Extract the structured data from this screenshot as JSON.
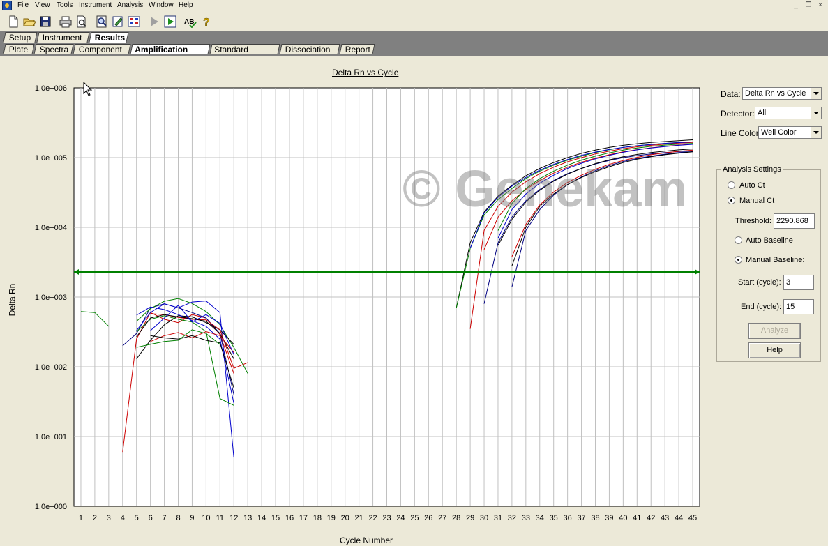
{
  "menu": [
    "File",
    "View",
    "Tools",
    "Instrument",
    "Analysis",
    "Window",
    "Help"
  ],
  "window_buttons": [
    "_",
    "❐",
    "×"
  ],
  "main_tabs": [
    "Setup",
    "Instrument",
    "Results"
  ],
  "result_tabs": [
    "Plate",
    "Spectra",
    "Component",
    "Amplification Plot",
    "Standard Curve",
    "Dissociation",
    "Report"
  ],
  "watermark": "© Genekam",
  "controls": {
    "data_label": "Data:",
    "data_value": "Delta Rn vs Cycle",
    "detector_label": "Detector:",
    "detector_value": "All",
    "line_color_label": "Line Color:",
    "line_color_value": "Well Color",
    "analysis_settings": "Analysis Settings",
    "auto_ct": "Auto Ct",
    "manual_ct": "Manual Ct",
    "threshold_label": "Threshold:",
    "threshold_value": "2290.868",
    "auto_baseline": "Auto Baseline",
    "manual_baseline": "Manual Baseline:",
    "start_label": "Start (cycle):",
    "start_value": "3",
    "end_label": "End (cycle):",
    "end_value": "15",
    "analyze_button": "Analyze",
    "help_button": "Help",
    "selected_ct_mode": "manual",
    "selected_baseline_mode": "manual"
  },
  "chart_data": {
    "type": "line",
    "title": "Delta Rn vs Cycle",
    "xlabel": "Cycle Number",
    "ylabel": "Delta Rn",
    "yscale": "log",
    "xlim": [
      1,
      45
    ],
    "ylim": [
      1,
      1000000
    ],
    "x_ticks": [
      "1",
      "2",
      "3",
      "4",
      "5",
      "6",
      "7",
      "8",
      "9",
      "10",
      "11",
      "12",
      "13",
      "14",
      "15",
      "16",
      "17",
      "18",
      "19",
      "20",
      "21",
      "22",
      "23",
      "24",
      "25",
      "26",
      "27",
      "28",
      "29",
      "30",
      "31",
      "32",
      "33",
      "34",
      "35",
      "36",
      "37",
      "38",
      "39",
      "40",
      "41",
      "42",
      "43",
      "44",
      "45"
    ],
    "y_ticks": [
      "1.0e+000",
      "1.0e+001",
      "1.0e+002",
      "1.0e+003",
      "1.0e+004",
      "1.0e+005",
      "1.0e+006"
    ],
    "threshold": 2290.868,
    "threshold_color": "#008000",
    "grid": true,
    "series": [
      {
        "color": "#008000",
        "x": [
          1,
          2,
          3
        ],
        "y": [
          620,
          600,
          380
        ]
      },
      {
        "color": "#cc0000",
        "x": [
          4,
          5,
          6,
          7,
          8,
          9,
          10,
          11,
          12
        ],
        "y": [
          6,
          250,
          600,
          480,
          430,
          560,
          500,
          290,
          80
        ]
      },
      {
        "color": "#000080",
        "x": [
          4,
          5,
          6,
          7,
          8,
          9,
          10,
          11,
          12
        ],
        "y": [
          200,
          300,
          700,
          800,
          700,
          600,
          500,
          300,
          40
        ]
      },
      {
        "color": "#008000",
        "x": [
          5,
          6,
          7,
          8,
          9,
          10,
          11,
          12,
          13
        ],
        "y": [
          450,
          680,
          870,
          950,
          810,
          620,
          400,
          190,
          80
        ]
      },
      {
        "color": "#0000cc",
        "x": [
          5,
          6,
          7,
          8,
          9,
          10,
          11,
          12
        ],
        "y": [
          330,
          600,
          800,
          700,
          850,
          880,
          600,
          5
        ]
      },
      {
        "color": "#000000",
        "x": [
          5,
          6,
          7,
          8,
          9,
          10,
          11,
          12
        ],
        "y": [
          130,
          240,
          400,
          540,
          520,
          430,
          340,
          210
        ]
      },
      {
        "color": "#cc0000",
        "x": [
          6,
          7,
          8,
          9,
          10,
          11,
          12,
          13
        ],
        "y": [
          580,
          560,
          510,
          480,
          470,
          340,
          95,
          115
        ]
      },
      {
        "color": "#008000",
        "x": [
          5,
          6,
          7,
          8,
          9,
          10,
          11,
          12
        ],
        "y": [
          320,
          480,
          540,
          480,
          440,
          320,
          35,
          28
        ]
      },
      {
        "color": "#0000cc",
        "x": [
          5,
          6,
          7,
          8,
          9,
          10,
          11,
          12
        ],
        "y": [
          550,
          720,
          660,
          560,
          460,
          380,
          250,
          30
        ]
      },
      {
        "color": "#000000",
        "x": [
          5,
          6,
          7,
          8,
          9,
          10,
          11,
          12
        ],
        "y": [
          270,
          500,
          560,
          520,
          490,
          450,
          300,
          130
        ]
      },
      {
        "color": "#cc0000",
        "x": [
          6,
          7,
          8,
          9,
          10,
          11,
          12
        ],
        "y": [
          230,
          280,
          310,
          260,
          320,
          280,
          160
        ]
      },
      {
        "color": "#0000cc",
        "x": [
          6,
          7,
          8,
          9,
          10,
          11,
          12
        ],
        "y": [
          330,
          500,
          760,
          440,
          560,
          420,
          150
        ]
      },
      {
        "color": "#000000",
        "x": [
          6,
          7,
          8,
          9,
          10,
          11,
          12
        ],
        "y": [
          280,
          260,
          250,
          280,
          240,
          220,
          50
        ]
      },
      {
        "color": "#008000",
        "x": [
          5,
          6,
          7,
          8,
          9,
          10,
          11
        ],
        "y": [
          190,
          210,
          230,
          240,
          340,
          300,
          210
        ]
      },
      {
        "color": "#000000",
        "x": [
          28,
          29,
          30,
          31,
          32,
          33,
          34,
          35,
          36,
          37,
          38,
          39,
          40,
          41,
          42,
          43,
          44,
          45
        ],
        "y": [
          700,
          6000,
          16500,
          28000,
          40000,
          55000,
          70000,
          85000,
          100000,
          115000,
          128000,
          140000,
          150000,
          158000,
          165000,
          170000,
          175000,
          180000
        ]
      },
      {
        "color": "#008000",
        "x": [
          28,
          29,
          30,
          31,
          32,
          33,
          34,
          35,
          36,
          37,
          38,
          39,
          40,
          41,
          42,
          43,
          44,
          45
        ],
        "y": [
          700,
          5000,
          15000,
          25000,
          36000,
          50000,
          64000,
          78000,
          92000,
          105000,
          118000,
          130000,
          140000,
          148000,
          155000,
          160000,
          165000,
          168000
        ]
      },
      {
        "color": "#cc0000",
        "x": [
          29,
          30,
          31,
          32,
          33,
          34,
          35,
          36,
          37,
          38,
          39,
          40,
          41,
          42,
          43,
          44,
          45
        ],
        "y": [
          350,
          9000,
          20000,
          32000,
          45000,
          59000,
          73000,
          87000,
          100000,
          113000,
          124000,
          134000,
          143000,
          150000,
          156000,
          161000,
          165000
        ]
      },
      {
        "color": "#0000cc",
        "x": [
          29,
          30,
          31,
          32,
          33,
          34,
          35,
          36,
          37,
          38,
          39,
          40,
          41,
          42,
          43,
          44,
          45
        ],
        "y": [
          5000,
          16000,
          27000,
          39000,
          52000,
          66000,
          80000,
          94000,
          108000,
          120000,
          131000,
          140000,
          148000,
          154000,
          160000,
          164000,
          168000
        ]
      },
      {
        "color": "#000080",
        "x": [
          30,
          31,
          32,
          33,
          34,
          35,
          36,
          37,
          38,
          39,
          40,
          41,
          42,
          43,
          44,
          45
        ],
        "y": [
          800,
          6000,
          14000,
          24000,
          35000,
          47000,
          59000,
          70000,
          81000,
          91000,
          100000,
          107000,
          113000,
          118000,
          122000,
          125000
        ]
      },
      {
        "color": "#cc0000",
        "x": [
          30,
          31,
          32,
          33,
          34,
          35,
          36,
          37,
          38,
          39,
          40,
          41,
          42,
          43,
          44,
          45
        ],
        "y": [
          4800,
          14000,
          24000,
          35000,
          47000,
          60000,
          73000,
          86000,
          98000,
          110000,
          121000,
          130000,
          138000,
          145000,
          151000,
          156000
        ]
      },
      {
        "color": "#000000",
        "x": [
          31,
          32,
          33,
          34,
          35,
          36,
          37,
          38,
          39,
          40,
          41,
          42,
          43,
          44,
          45
        ],
        "y": [
          5500,
          13000,
          23000,
          34000,
          46000,
          58000,
          70000,
          82000,
          93000,
          103000,
          111000,
          118000,
          124000,
          129000,
          133000
        ]
      },
      {
        "color": "#000080",
        "x": [
          32,
          33,
          34,
          35,
          36,
          37,
          38,
          39,
          40,
          41,
          42,
          43,
          44,
          45
        ],
        "y": [
          1400,
          9000,
          18000,
          29000,
          41000,
          53000,
          65000,
          77000,
          88000,
          97000,
          105000,
          112000,
          118000,
          122000
        ]
      },
      {
        "color": "#cc0000",
        "x": [
          32,
          33,
          34,
          35,
          36,
          37,
          38,
          39,
          40,
          41,
          42,
          43,
          44,
          45
        ],
        "y": [
          3800,
          11000,
          21000,
          32000,
          44000,
          56000,
          68000,
          80000,
          91000,
          101000,
          110000,
          117000,
          123000,
          128000
        ]
      },
      {
        "color": "#000000",
        "x": [
          32,
          33,
          34,
          35,
          36,
          37,
          38,
          39,
          40,
          41,
          42,
          43,
          44,
          45
        ],
        "y": [
          2800,
          10000,
          20000,
          30000,
          41000,
          52000,
          63000,
          74000,
          85000,
          95000,
          103000,
          110000,
          116000,
          121000
        ]
      },
      {
        "color": "#008000",
        "x": [
          31,
          32,
          33,
          34,
          35,
          36,
          37,
          38,
          39,
          40,
          41,
          42,
          43,
          44,
          45
        ],
        "y": [
          9000,
          22000,
          36000,
          50000,
          64000,
          78000,
          92000,
          105000,
          117000,
          128000,
          137000,
          145000,
          151000,
          156000,
          160000
        ]
      },
      {
        "color": "#0000cc",
        "x": [
          31,
          32,
          33,
          34,
          35,
          36,
          37,
          38,
          39,
          40,
          41,
          42,
          43,
          44,
          45
        ],
        "y": [
          7000,
          18000,
          30000,
          43000,
          56000,
          70000,
          83000,
          96000,
          108000,
          119000,
          129000,
          137000,
          144000,
          150000,
          155000
        ]
      }
    ]
  }
}
